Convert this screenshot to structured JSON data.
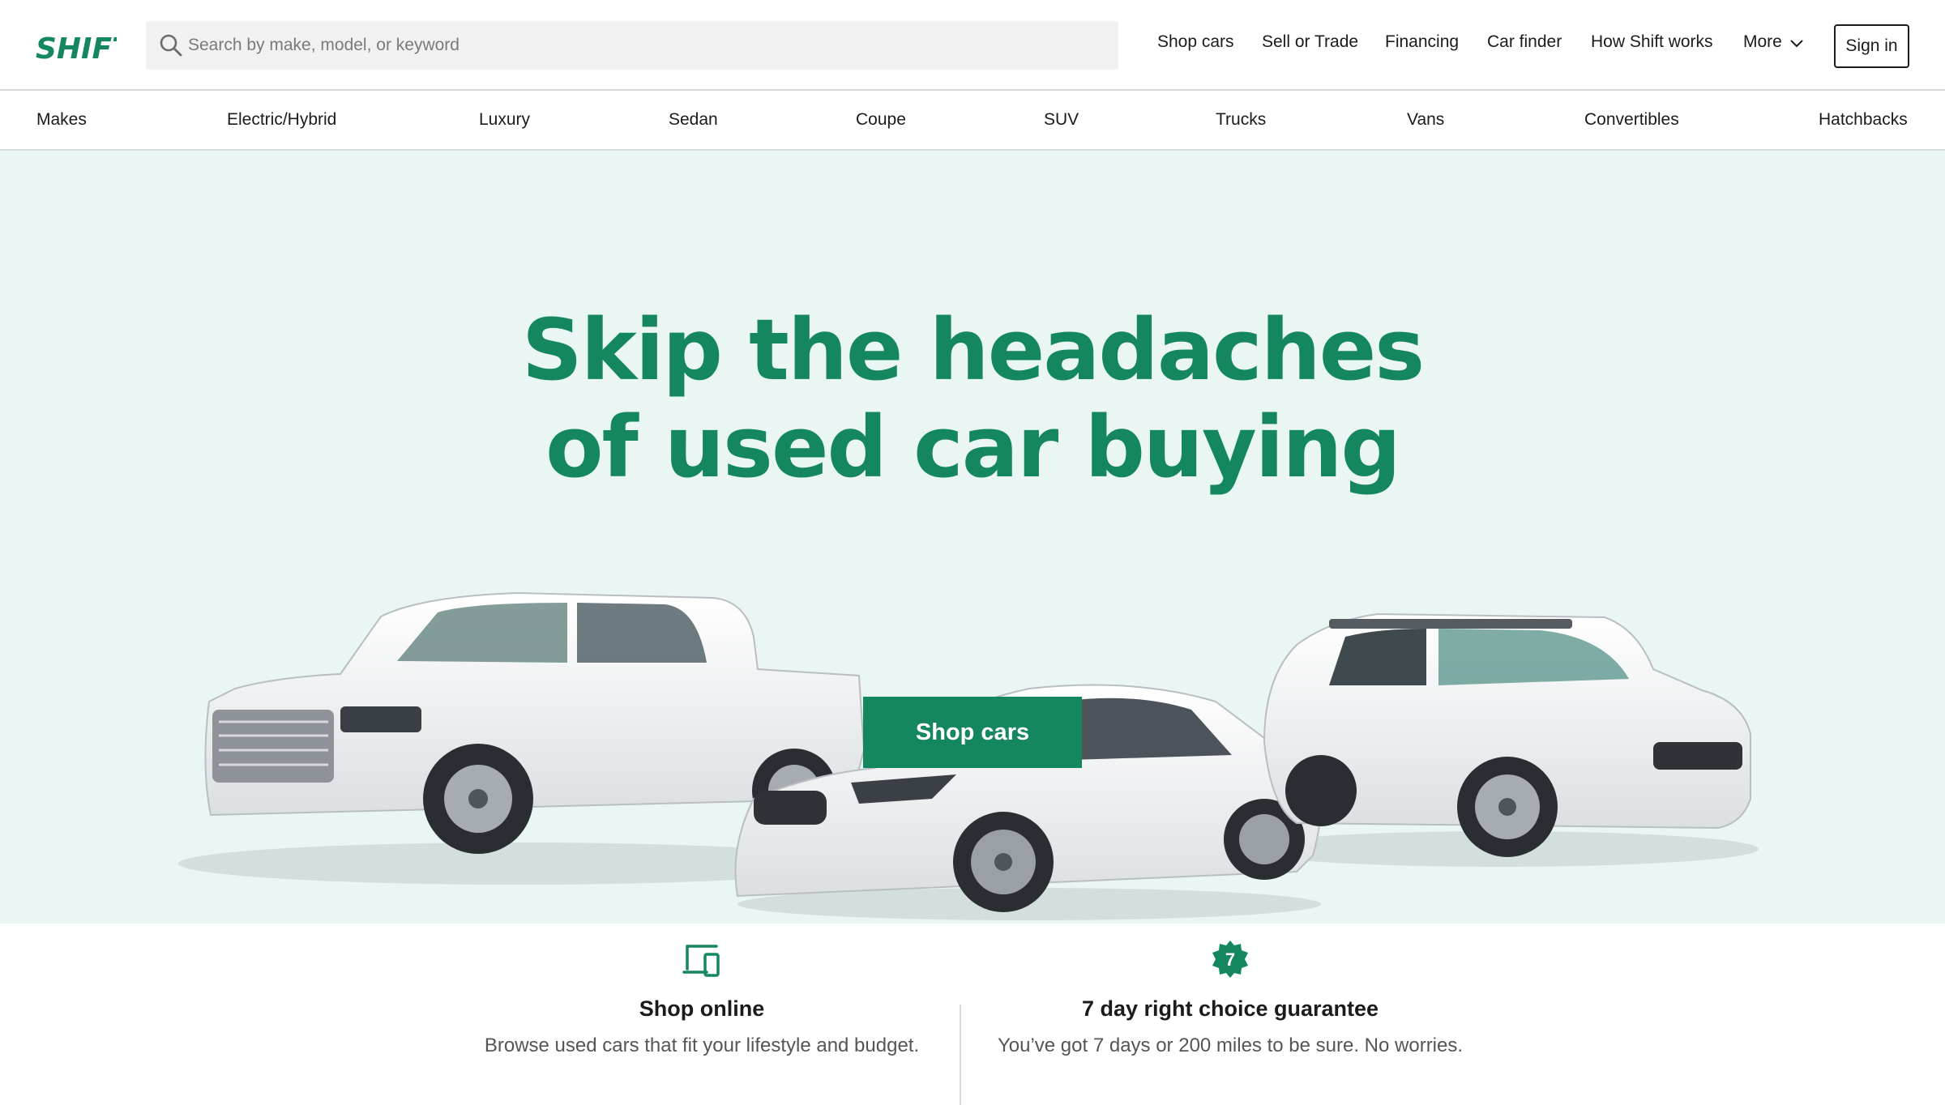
{
  "brand": {
    "logo_text": "SHIFT",
    "accent": "#15875f",
    "hero_bg": "#e9f6f4"
  },
  "search": {
    "placeholder": "Search by make, model, or keyword",
    "icon": "search-icon"
  },
  "nav": {
    "shop_cars": "Shop cars",
    "sell_trade": "Sell or Trade",
    "financing": "Financing",
    "car_finder": "Car finder",
    "how_it_works": "How Shift works",
    "more": "More",
    "more_icon": "chevron-down-icon",
    "sign_in": "Sign in"
  },
  "categories": [
    "Makes",
    "Electric/Hybrid",
    "Luxury",
    "Sedan",
    "Coupe",
    "SUV",
    "Trucks",
    "Vans",
    "Convertibles",
    "Hatchbacks"
  ],
  "hero": {
    "headline_line1": "Skip the headaches",
    "headline_line2": "of used car buying",
    "cta": "Shop cars"
  },
  "features": [
    {
      "icon": "devices-icon",
      "title": "Shop online",
      "description": "Browse used cars that fit your lifestyle and budget."
    },
    {
      "icon": "badge-7-icon",
      "badge_text": "7",
      "title": "7 day right choice guarantee",
      "description": "You’ve got 7 days or 200 miles to be sure. No worries."
    }
  ]
}
